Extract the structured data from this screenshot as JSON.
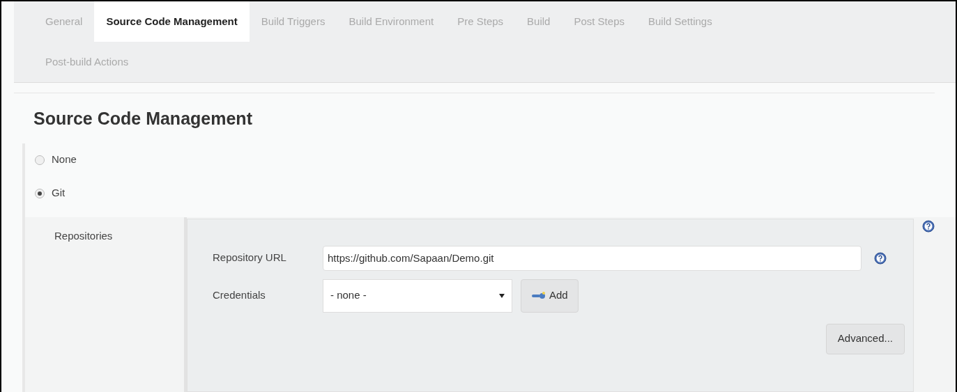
{
  "tabs": [
    {
      "label": "General",
      "selected": false
    },
    {
      "label": "Source Code Management",
      "selected": true
    },
    {
      "label": "Build Triggers",
      "selected": false
    },
    {
      "label": "Build Environment",
      "selected": false
    },
    {
      "label": "Pre Steps",
      "selected": false
    },
    {
      "label": "Build",
      "selected": false
    },
    {
      "label": "Post Steps",
      "selected": false
    },
    {
      "label": "Build Settings",
      "selected": false
    },
    {
      "label": "Post-build Actions",
      "selected": false
    }
  ],
  "section_title": "Source Code Management",
  "scm_options": [
    {
      "label": "None",
      "selected": false
    },
    {
      "label": "Git",
      "selected": true
    }
  ],
  "repositories": {
    "label": "Repositories",
    "url_label": "Repository URL",
    "url_value": "https://github.com/Sapaan/Demo.git",
    "credentials_label": "Credentials",
    "credentials_value": "- none -",
    "add_button": "Add",
    "advanced_button": "Advanced..."
  }
}
